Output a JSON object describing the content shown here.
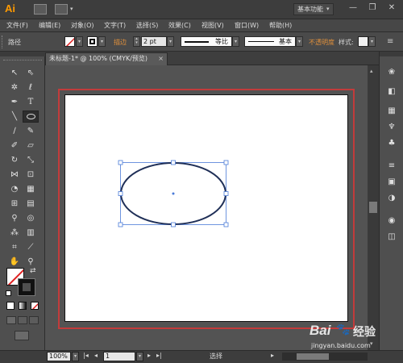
{
  "app": {
    "logo": "Ai",
    "workspace": "基本功能"
  },
  "window_controls": {
    "minimize": "—",
    "restore": "❐",
    "close": "✕"
  },
  "menu": [
    "文件(F)",
    "编辑(E)",
    "对象(O)",
    "文字(T)",
    "选择(S)",
    "效果(C)",
    "视图(V)",
    "窗口(W)",
    "帮助(H)"
  ],
  "control": {
    "selection_type": "路径",
    "stroke_label": "描边",
    "stroke_value": "2 pt",
    "stroke_profile_uniform": "等比",
    "brush_basic": "基本",
    "opacity_label": "不透明度",
    "style_label": "样式:"
  },
  "document_tab": {
    "title": "未标题-1* @ 100% (CMYK/预览)",
    "close": "×"
  },
  "status": {
    "zoom": "100%",
    "artboard": "1",
    "tool": "选择"
  },
  "watermark": {
    "brand": "Bai",
    "brand2": "经验",
    "url": "jingyan.baidu.com"
  },
  "colors": {
    "accent": "#ff9a00",
    "bleed": "#c23b3b",
    "ellipse_stroke": "#1f2f57",
    "selection": "#4a7bd8"
  }
}
